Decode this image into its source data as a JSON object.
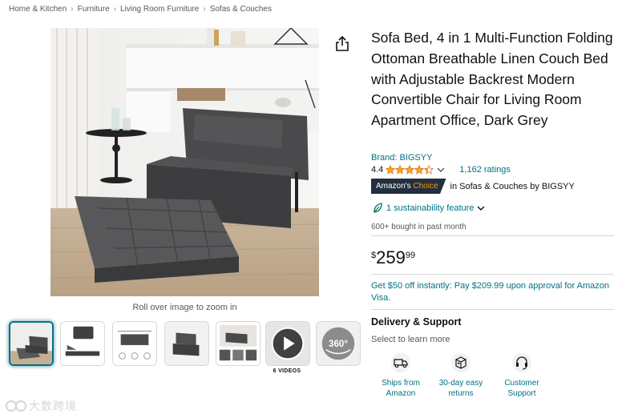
{
  "breadcrumb": [
    "Home & Kitchen",
    "Furniture",
    "Living Room Furniture",
    "Sofas & Couches"
  ],
  "breadcrumb_separator": "›",
  "gallery": {
    "zoom_hint": "Roll over image to zoom in",
    "videos_label": "6 VIDEOS",
    "thumbnail_count": 7,
    "spin_label": "360°"
  },
  "product": {
    "title": "Sofa Bed, 4 in 1 Multi-Function Folding Ottoman Breathable Linen Couch Bed with Adjustable Backrest Modern Convertible Chair for Living Room Apartment Office, Dark Grey",
    "brand": "Brand: BIGSYY",
    "rating": "4.4",
    "rating_value": 4.4,
    "ratings_count": "1,162 ratings",
    "choice_badge_prefix": "Amazon's",
    "choice_badge_suffix": "Choice",
    "choice_in": "in",
    "choice_category": "Sofas & Couches",
    "choice_by": "by BIGSYY",
    "sustainability": "1 sustainability feature",
    "bought": "600+ bought in past month",
    "price_symbol": "$",
    "price_whole": "259",
    "price_fraction": "99",
    "offer": "Get $50 off instantly: Pay $209.99 upon approval for Amazon Visa."
  },
  "delivery": {
    "title": "Delivery & Support",
    "subtitle": "Select to learn more",
    "features": [
      {
        "label": "Ships from Amazon",
        "icon": "truck-icon"
      },
      {
        "label": "30-day easy returns",
        "icon": "return-box-icon"
      },
      {
        "label": "Customer Support",
        "icon": "headset-icon"
      }
    ]
  },
  "watermark_text": "大数跨境",
  "colors": {
    "link": "#007185",
    "star": "#ffa41c",
    "badge_bg": "#232f3e",
    "badge_accent": "#ff9900",
    "selected_thumb": "#007185"
  }
}
